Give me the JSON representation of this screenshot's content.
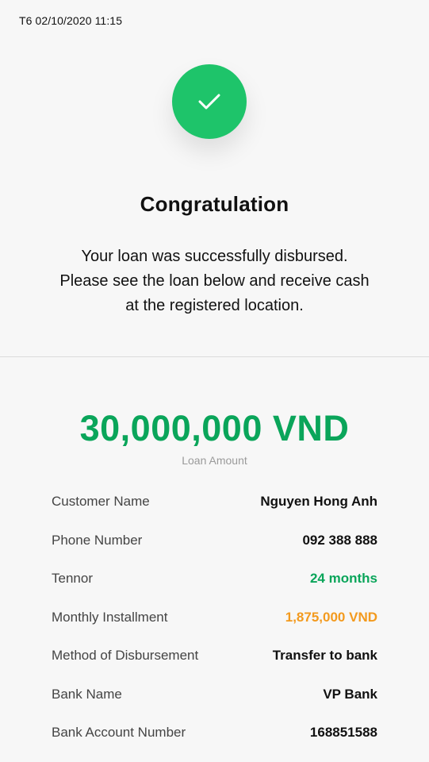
{
  "status_bar": {
    "datetime": "T6 02/10/2020 11:15"
  },
  "success": {
    "icon": "check-icon",
    "badge_color": "#1ec46a",
    "title": "Congratulation",
    "message_lines": [
      "Your loan was successfully disbursed.",
      "Please see the loan below and receive cash",
      "at the registered location."
    ]
  },
  "loan": {
    "amount": "30,000,000 VND",
    "amount_color": "#0aa55a",
    "amount_caption": "Loan Amount",
    "details": [
      {
        "label": "Customer Name",
        "value": "Nguyen Hong Anh",
        "tone": "default"
      },
      {
        "label": "Phone Number",
        "value": "092 388 888",
        "tone": "default"
      },
      {
        "label": "Tennor",
        "value": "24 months",
        "tone": "green"
      },
      {
        "label": "Monthly Installment",
        "value": "1,875,000 VND",
        "tone": "orange"
      },
      {
        "label": "Method of Disbursement",
        "value": "Transfer to bank",
        "tone": "default"
      },
      {
        "label": "Bank Name",
        "value": "VP Bank",
        "tone": "default"
      },
      {
        "label": "Bank Account Number",
        "value": "168851588",
        "tone": "default"
      }
    ]
  },
  "colors": {
    "accent_green": "#0aa55a",
    "accent_orange": "#f39a1e"
  }
}
